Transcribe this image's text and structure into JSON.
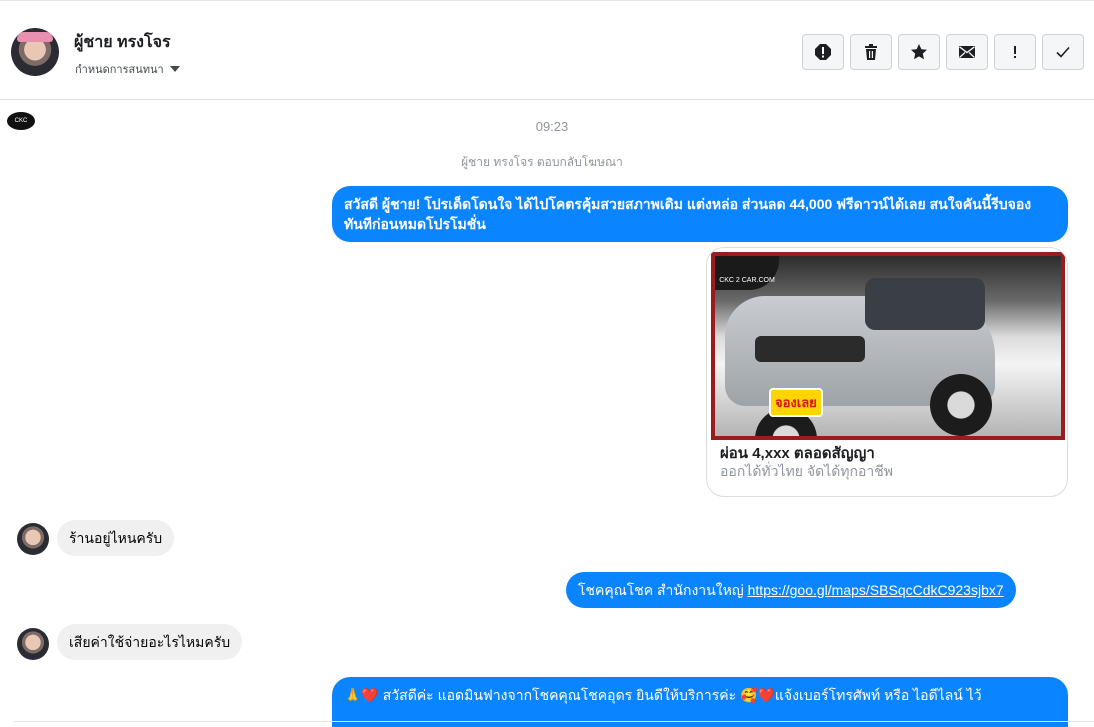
{
  "header": {
    "contact_name": "ผู้ชาย ทรงโจร",
    "conversation_label": "กำหนดการสนทนา",
    "toolbar": [
      {
        "icon": "alert-icon",
        "glyph": "!"
      },
      {
        "icon": "trash-icon",
        "glyph": "🗑"
      },
      {
        "icon": "star-icon",
        "glyph": "★"
      },
      {
        "icon": "envelope-icon",
        "glyph": "✉"
      },
      {
        "icon": "exclamation-icon",
        "glyph": "!"
      },
      {
        "icon": "check-icon",
        "glyph": "✓"
      }
    ]
  },
  "thread": {
    "timestamp": "09:23",
    "reply_note": "ผู้ชาย ทรงโจร ตอบกลับโฆษณา",
    "page_logo_text": "CKC",
    "messages": {
      "m1": "สวัสดี ผู้ชาย! โปรเด็ดโดนใจ ได้ไปโคตรคุ้มสวยสภาพเดิม แต่งหล่อ  ส่วนลด 44,000 ฟรีดาวน์ได้เลย  สนใจคันนี้รีบจองทันทีก่อนหมดโปรโมชั่น",
      "m2_in": "ร้านอยู่ไหนครับ",
      "m3_prefix": "โชคคุณโชค สำนักงานใหญ่ ",
      "m3_link": "https://goo.gl/maps/SBSqcCdkC923sjbx7",
      "m4_in": "เสียค่าใช้จ่ายอะไรไหมครับ",
      "m5": "🙏❤️ สวัสดีค่ะ แอดมินฟางจากโชคคุณโชคอุดร ยินดีให้บริการค่ะ  🥰❤️แจ้งเบอร์โทรศัพท์ หรือ ไอดีไลน์  ไว้"
    },
    "card": {
      "image_badge": "CKC 2 CAR.COM",
      "image_sticker": "จองเลย",
      "title": "ผ่อน 4,xxx ตลอดสัญญา",
      "subtitle": "ออกได้ทั่วไทย จัดได้ทุกอาชีพ"
    }
  },
  "colors": {
    "outgoing": "#0b84ff",
    "incoming": "#f1f0f0",
    "muted_text": "#90949c"
  }
}
